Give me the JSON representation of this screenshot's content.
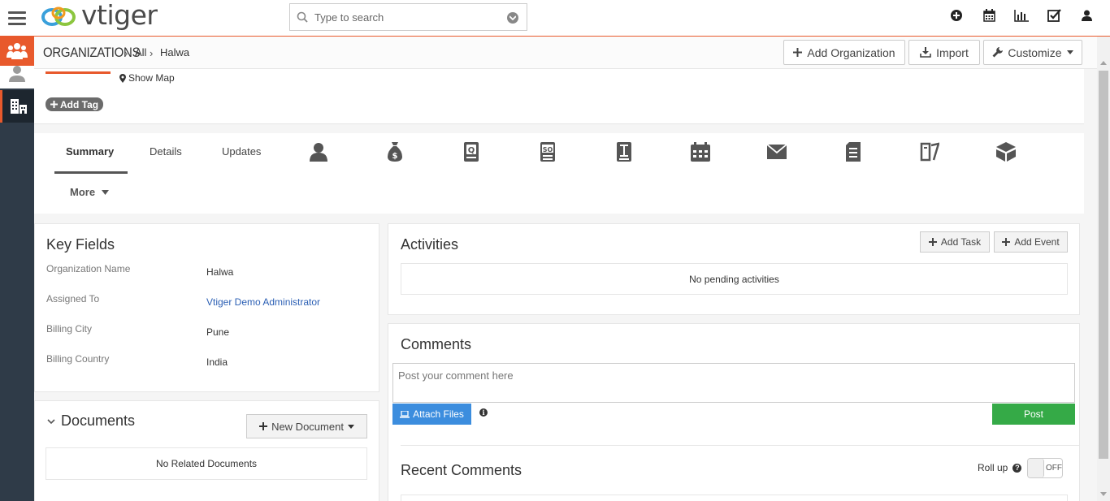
{
  "app": {
    "logo_text": "vtiger",
    "search_placeholder": "Type to search"
  },
  "breadcrumb": {
    "module": "ORGANIZATIONS",
    "filter": "All",
    "record": "Halwa"
  },
  "actions": {
    "add_organization": "Add Organization",
    "import": "Import",
    "customize": "Customize"
  },
  "header": {
    "show_map": "Show Map",
    "add_tag": "Add Tag"
  },
  "tabs": {
    "summary": "Summary",
    "details": "Details",
    "updates": "Updates",
    "more": "More",
    "related_icons": [
      "contacts-icon",
      "money-bag-icon",
      "quotes-icon",
      "sales-order-icon",
      "invoice-icon",
      "calendar-icon",
      "email-icon",
      "document-icon",
      "tickets-icon",
      "products-icon"
    ]
  },
  "key_fields": {
    "title": "Key Fields",
    "fields": [
      {
        "label": "Organization Name",
        "value": "Halwa"
      },
      {
        "label": "Assigned To",
        "value": "Vtiger Demo Administrator"
      },
      {
        "label": "Billing City",
        "value": "Pune"
      },
      {
        "label": "Billing Country",
        "value": "India"
      }
    ]
  },
  "documents": {
    "title": "Documents",
    "new_button": "New Document",
    "empty": "No Related Documents"
  },
  "activities": {
    "title": "Activities",
    "add_task": "Add Task",
    "add_event": "Add Event",
    "empty": "No pending activities"
  },
  "comments": {
    "title": "Comments",
    "placeholder": "Post your comment here",
    "attach": "Attach Files",
    "post": "Post",
    "recent_title": "Recent Comments",
    "rollup_label": "Roll up",
    "rollup_state": "OFF"
  },
  "colors": {
    "accent": "#e8592c",
    "rail": "#2f3b48",
    "link": "#2b5fb4",
    "post": "#35aa47",
    "attach": "#3c8dde"
  }
}
